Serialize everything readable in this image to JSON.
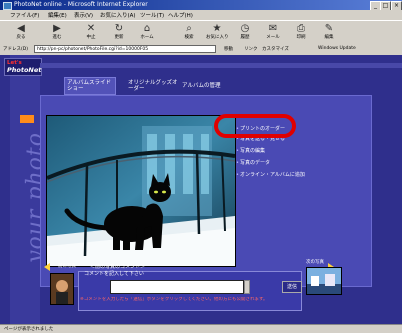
{
  "window": {
    "title": "PhotoNet online - Microsoft Internet Explorer",
    "buttons": {
      "minimize": "_",
      "maximize": "□",
      "close": "×"
    }
  },
  "menubar": {
    "items": [
      "ファイル(F)",
      "編集(E)",
      "表示(V)",
      "お気に入り(A)",
      "ツール(T)",
      "ヘルプ(H)"
    ]
  },
  "toolbar": {
    "buttons": [
      {
        "label": "戻る",
        "icon": "back-arrow-icon",
        "glyph": "◀"
      },
      {
        "label": "進む",
        "icon": "forward-arrow-icon",
        "glyph": "▶"
      },
      {
        "label": "中止",
        "icon": "stop-icon",
        "glyph": "✕"
      },
      {
        "label": "更新",
        "icon": "refresh-icon",
        "glyph": "↻"
      },
      {
        "label": "ホーム",
        "icon": "home-icon",
        "glyph": "⌂"
      },
      {
        "label": "検索",
        "icon": "search-icon",
        "glyph": "⌕"
      },
      {
        "label": "お気に入り",
        "icon": "favorites-icon",
        "glyph": "★"
      },
      {
        "label": "履歴",
        "icon": "history-icon",
        "glyph": "◷"
      },
      {
        "label": "メール",
        "icon": "mail-icon",
        "glyph": "✉"
      },
      {
        "label": "印刷",
        "icon": "print-icon",
        "glyph": "⎙"
      },
      {
        "label": "編集",
        "icon": "edit-icon",
        "glyph": "✎"
      }
    ]
  },
  "addressbar": {
    "label": "アドレス(D)",
    "url": "http://pn-pc/photonet/PhotoFile.cgi?id=10000F05",
    "go": "移動",
    "links": "リンク",
    "extra1": "カスタマイズ",
    "extra2": "Windows Update"
  },
  "page": {
    "logo": {
      "line1": "Let's",
      "line2": "PhotoNet"
    },
    "vertical_text": "your photo",
    "tabs": {
      "tab1": "アルバムスライドショー",
      "tab2": "オリジナルグッズオーダー",
      "tab3": "アルバムの管理"
    },
    "sidelinks": [
      "プリントのオーダー",
      "写真を送る・見せる",
      "写真の編集",
      "写真のデータ",
      "オンライン・アルバムに追加"
    ],
    "nav": {
      "prev": "前の写真",
      "text": "＜前の写真のコメント＞",
      "next": "次の写真"
    },
    "comment": {
      "label": "コメントを記入して下さい",
      "send": "送信",
      "note": "※コメントを入力したら「送信」ボタンをクリックしてください。他の方にも公開されます。"
    },
    "status": "ページが表示されました"
  }
}
